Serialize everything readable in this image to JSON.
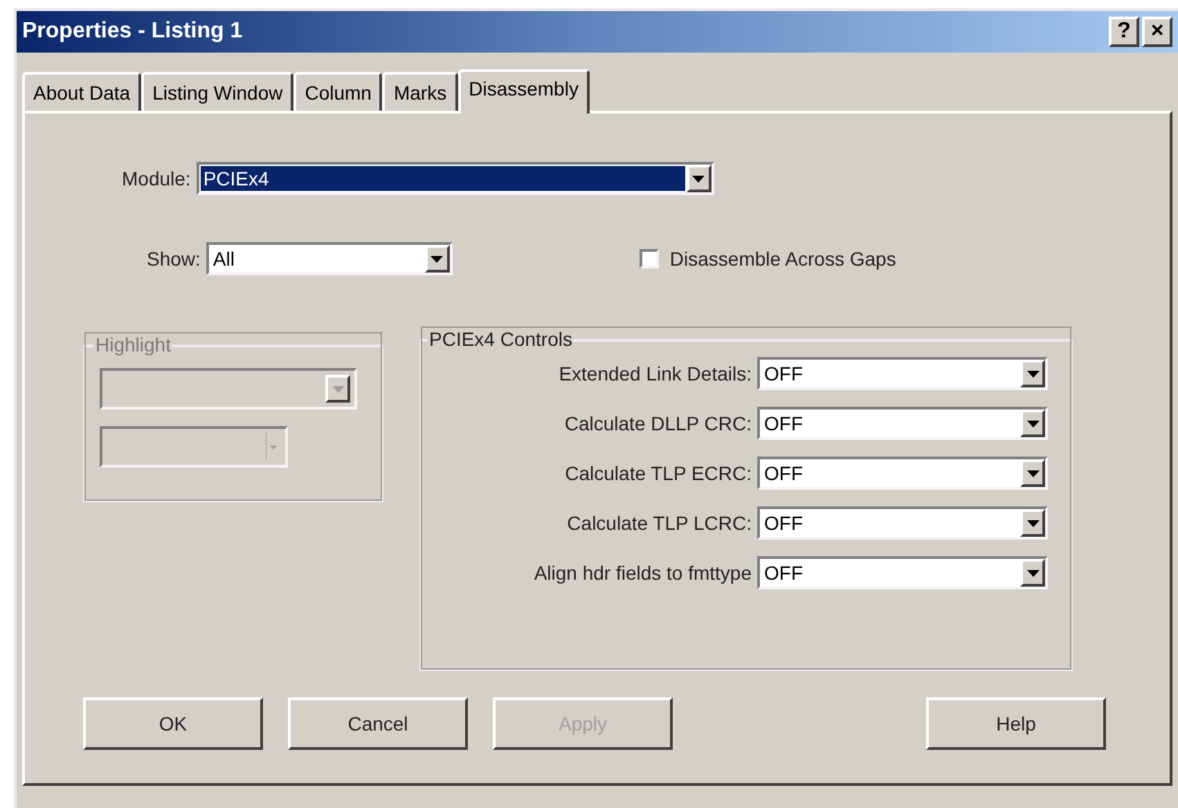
{
  "window": {
    "title": "Properties - Listing 1",
    "title_buttons": [
      "?",
      "×"
    ]
  },
  "tabs": [
    {
      "label": "About Data",
      "selected": false
    },
    {
      "label": "Listing Window",
      "selected": false
    },
    {
      "label": "Column",
      "selected": false
    },
    {
      "label": "Marks",
      "selected": false
    },
    {
      "label": "Disassembly",
      "selected": true
    }
  ],
  "module": {
    "label": "Module:",
    "value": "PCIEx4",
    "selected": true
  },
  "show": {
    "label": "Show:",
    "value": "All"
  },
  "disassemble_across_gaps": {
    "label": "Disassemble Across Gaps",
    "checked": false
  },
  "highlight": {
    "title": "Highlight",
    "disabled": true
  },
  "controls": {
    "title": "PCIEx4 Controls",
    "rows": [
      {
        "label": "Extended Link Details:",
        "value": "OFF"
      },
      {
        "label": "Calculate DLLP CRC:",
        "value": "OFF"
      },
      {
        "label": "Calculate TLP ECRC:",
        "value": "OFF"
      },
      {
        "label": "Calculate TLP LCRC:",
        "value": "OFF"
      },
      {
        "label": "Align hdr fields to fmttype",
        "value": "OFF"
      }
    ]
  },
  "buttons": [
    {
      "label": "OK",
      "disabled": false
    },
    {
      "label": "Cancel",
      "disabled": false
    },
    {
      "label": "Apply",
      "disabled": true
    },
    {
      "label": "Help",
      "disabled": false
    }
  ]
}
